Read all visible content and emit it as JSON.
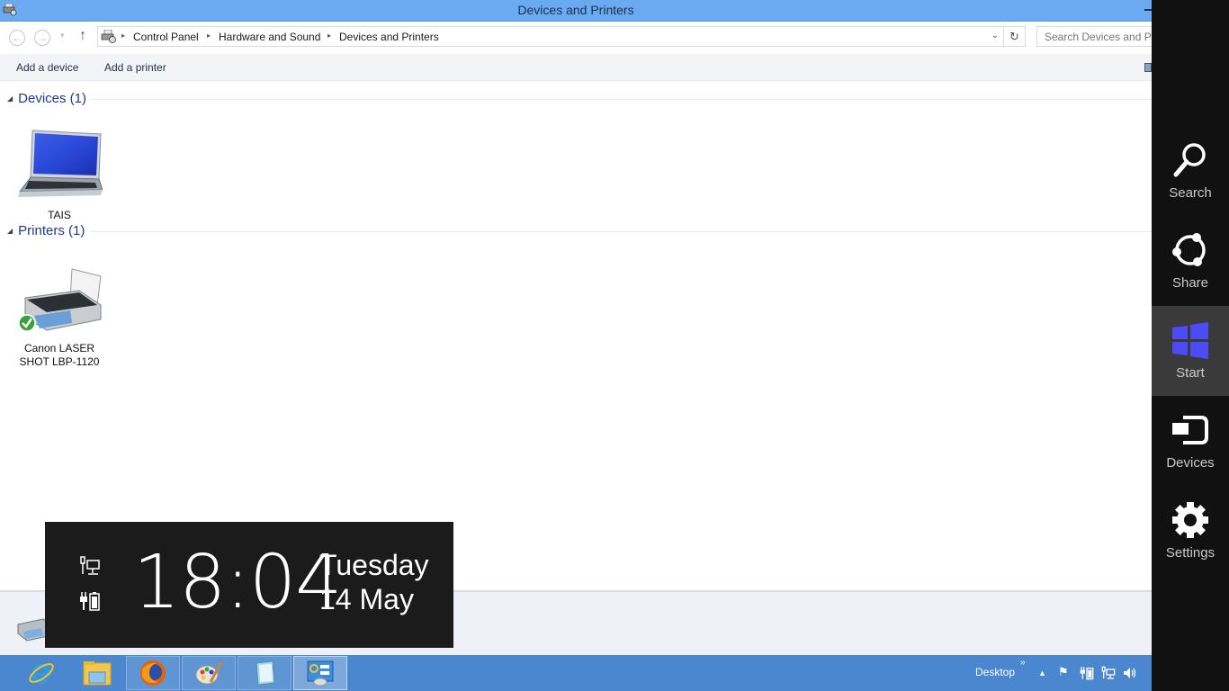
{
  "window": {
    "title": "Devices and Printers",
    "icons": {
      "app": "devices-printers-icon",
      "minimize": "minimize-icon"
    }
  },
  "address": {
    "back_icon": "back-arrow-icon",
    "forward_icon": "forward-arrow-icon",
    "recent_icon": "chevron-down-icon",
    "up_icon": "up-arrow-icon",
    "back_glyph": "←",
    "forward_glyph": "→",
    "recent_glyph": "▾",
    "up_glyph": "↑",
    "breadcrumbs": [
      "Control Panel",
      "Hardware and Sound",
      "Devices and Printers"
    ],
    "separator_glyph": "▸",
    "dropdown_glyph": "⌄",
    "refresh_glyph": "↻",
    "search_placeholder": "Search Devices and Pri"
  },
  "commands": {
    "add_device": "Add a device",
    "add_printer": "Add a printer"
  },
  "groups": [
    {
      "header": "Devices (1)",
      "items": [
        {
          "label": "TAIS",
          "icon": "laptop-icon"
        }
      ]
    },
    {
      "header": "Printers (1)",
      "items": [
        {
          "label_line1": "Canon LASER",
          "label_line2": "SHOT LBP-1120",
          "icon": "printer-icon",
          "status": "default-printer"
        }
      ]
    }
  ],
  "clock": {
    "time": "18:04",
    "day": "Tuesday",
    "date": "14 May",
    "network_icon": "network-icon",
    "battery_icon": "battery-charging-icon"
  },
  "taskbar": {
    "apps": [
      {
        "name": "Internet Explorer",
        "icon": "ie-icon"
      },
      {
        "name": "File Explorer",
        "icon": "folder-icon"
      },
      {
        "name": "Firefox",
        "icon": "firefox-icon"
      },
      {
        "name": "Paint",
        "icon": "paint-icon"
      },
      {
        "name": "Notepad",
        "icon": "notepad-icon"
      },
      {
        "name": "Control Panel",
        "icon": "control-panel-icon",
        "active": true
      }
    ],
    "desktop_label": "Desktop",
    "desktop_chev": "»",
    "tray_glyphs": {
      "expand": "▲",
      "flag": "⚑",
      "volume": "🔊"
    }
  },
  "charms": [
    {
      "label": "Search",
      "icon": "search-icon"
    },
    {
      "label": "Share",
      "icon": "share-icon"
    },
    {
      "label": "Start",
      "icon": "windows-logo-icon",
      "selected": true
    },
    {
      "label": "Devices",
      "icon": "devices-icon"
    },
    {
      "label": "Settings",
      "icon": "gear-icon"
    }
  ],
  "colors": {
    "titlebar": "#6aaaf0",
    "taskbar": "#4a87cf",
    "charms_bg": "#111111",
    "start_logo": "#4b4cf5",
    "group_header": "#1e3a8a"
  }
}
